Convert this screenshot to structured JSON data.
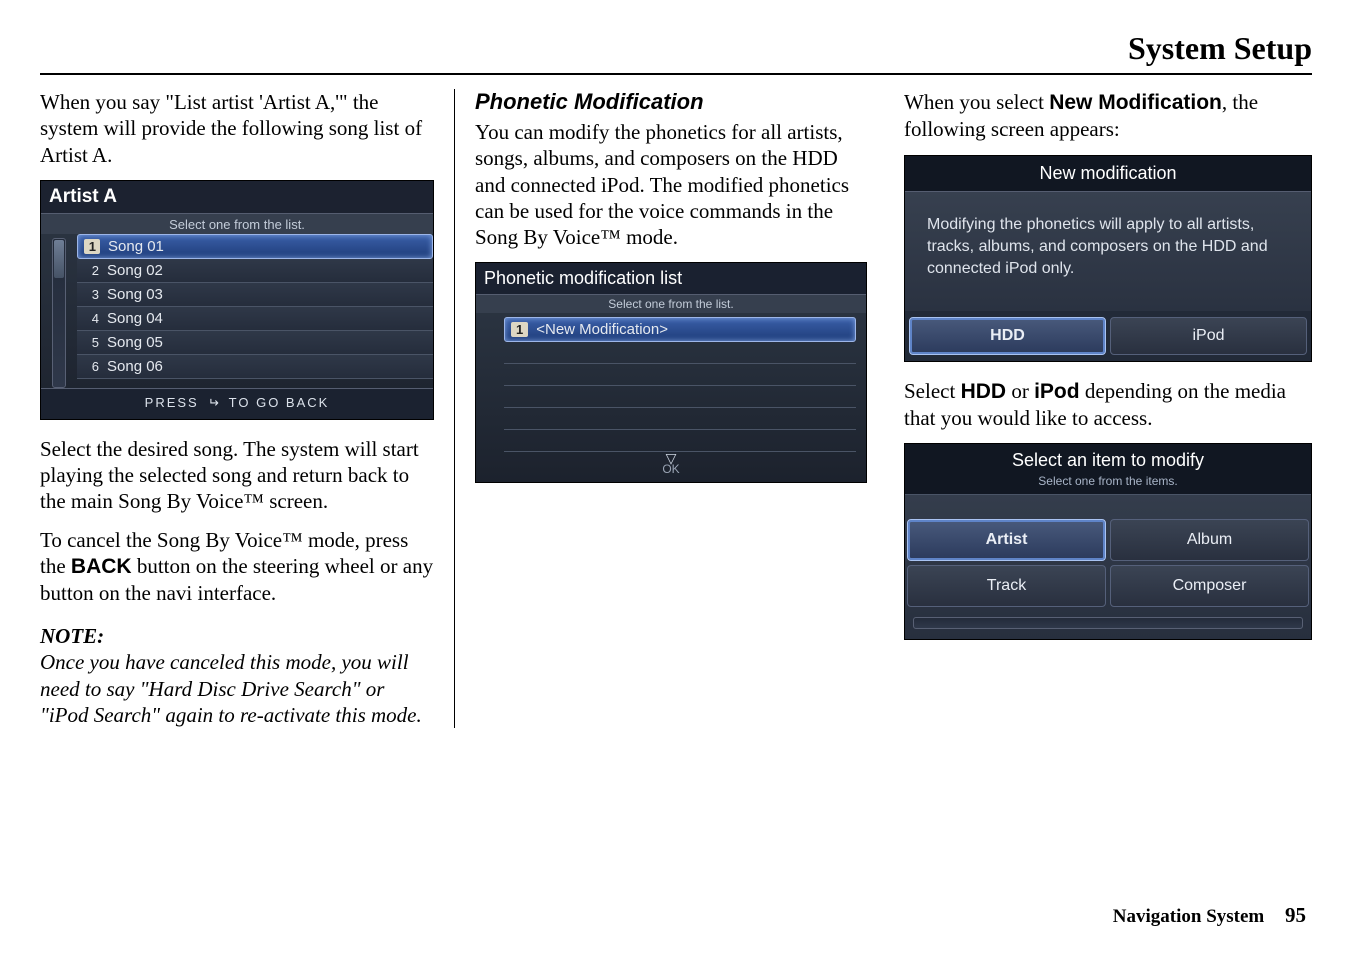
{
  "page_title": "System Setup",
  "col1": {
    "p1_pre": "When you say \"List artist 'Artist A,'\" the system will provide the following song list of Artist A.",
    "p2": "Select the desired song. The system will start playing the selected song and return back to the main Song By Voice™ screen.",
    "p3_a": "To cancel the Song By Voice™ mode, press the ",
    "p3_b": "BACK",
    "p3_c": " button on the steering wheel or any button on the navi interface.",
    "note_label": "NOTE:",
    "note_text": "Once you have canceled this mode, you will need to say \"Hard Disc Drive Search\" or \"iPod Search\" again to re-activate this mode."
  },
  "dev1": {
    "title": "Artist A",
    "hint": "Select one from the list.",
    "rows": [
      {
        "n": "1",
        "t": "Song 01"
      },
      {
        "n": "2",
        "t": "Song 02"
      },
      {
        "n": "3",
        "t": "Song 03"
      },
      {
        "n": "4",
        "t": "Song 04"
      },
      {
        "n": "5",
        "t": "Song 05"
      },
      {
        "n": "6",
        "t": "Song 06"
      }
    ],
    "footer_a": "PRESS",
    "footer_b": "TO GO BACK"
  },
  "col2": {
    "heading": "Phonetic Modification",
    "p1": "You can modify the phonetics for all artists, songs, albums, and composers on the HDD and connected iPod. The modified phonetics can be used for the voice commands in the Song By Voice™ mode."
  },
  "dev2": {
    "title": "Phonetic modification list",
    "hint": "Select one from the list.",
    "row_n": "1",
    "row_t": "<New Modification>",
    "ok": "OK"
  },
  "col3": {
    "p1_a": "When you select ",
    "p1_b": "New Modification",
    "p1_c": ", the following screen appears:",
    "p2_a": "Select ",
    "p2_b": "HDD",
    "p2_c": " or ",
    "p2_d": "iPod",
    "p2_e": " depending on the media that you would like to access."
  },
  "dev3": {
    "title": "New modification",
    "msg": "Modifying the phonetics will apply to all artists, tracks, albums, and composers on the HDD and connected iPod only.",
    "btn1": "HDD",
    "btn2": "iPod"
  },
  "dev4": {
    "title": "Select an item to modify",
    "hint": "Select one from the items.",
    "b1": "Artist",
    "b2": "Album",
    "b3": "Track",
    "b4": "Composer"
  },
  "footer": {
    "label": "Navigation System",
    "page": "95"
  }
}
